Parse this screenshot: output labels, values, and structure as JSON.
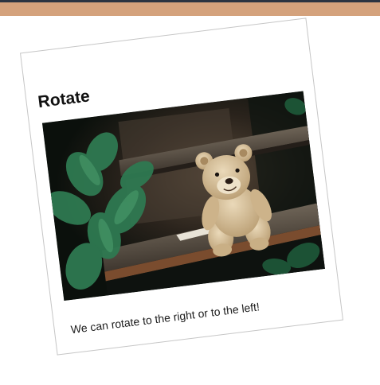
{
  "header": {
    "bar_color": "#d4a27c",
    "dark_strip_color": "#2b3441"
  },
  "card": {
    "title": "Rotate",
    "caption": "We can rotate to the right or to the left!",
    "rotation_direction": "counter-clockwise tilt",
    "image": {
      "subject": "teddy bear sitting on wooden stair step with green leaves",
      "icon": "photo-teddy-bear"
    }
  }
}
